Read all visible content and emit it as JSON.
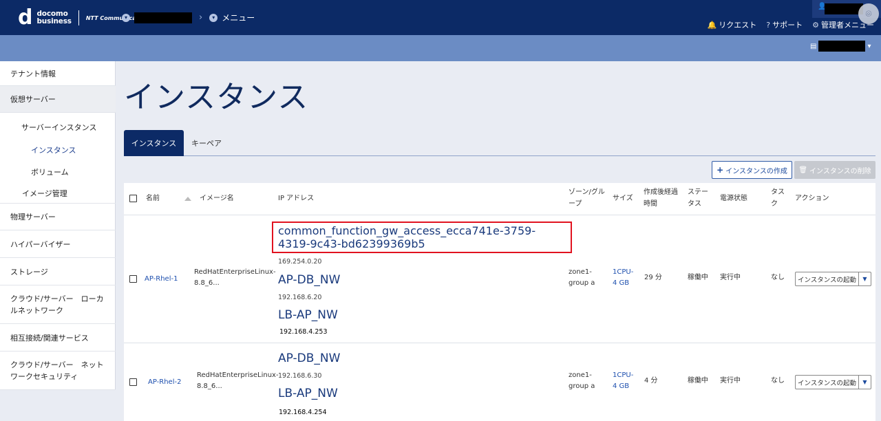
{
  "header": {
    "logo_docomo": "docomo",
    "logo_business": "business",
    "logo_ntt": "NTT Communications",
    "breadcrumb_menu": "メニュー",
    "request": "リクエスト",
    "support": "サポート",
    "admin_menu": "管理者メニュー"
  },
  "sidebar": {
    "tenant_info": "テナント情報",
    "virtual_server": "仮想サーバー",
    "server_instance": "サーバーインスタンス",
    "instance": "インスタンス",
    "volume": "ボリューム",
    "image_mgmt": "イメージ管理",
    "physical_server": "物理サーバー",
    "hypervisor": "ハイパーバイザー",
    "storage": "ストレージ",
    "cloud_local_net": "クラウド/サーバー　ローカルネットワーク",
    "interconnect": "相互接続/関連サービス",
    "cloud_net_security": "クラウド/サーバー　ネットワークセキュリティ"
  },
  "page": {
    "title": "インスタンス",
    "tabs": [
      "インスタンス",
      "キーペア"
    ],
    "create_button": "インスタンスの作成",
    "delete_button": "インスタンスの削除"
  },
  "table": {
    "headers": {
      "name": "名前",
      "image": "イメージ名",
      "ip": "IP アドレス",
      "zone": "ゾーン/グループ",
      "size": "サイズ",
      "elapsed": "作成後経過時間",
      "status": "ステータス",
      "power": "電源状態",
      "task": "タスク",
      "action": "アクション"
    },
    "rows": [
      {
        "name": "AP-Rhel-1",
        "image": "RedHatEnterpriseLinux-8.8_6...",
        "highlight_net": "common_function_gw_access_ecca741e-3759-4319-9c43-bd62399369b5",
        "ip1": "169.254.0.20",
        "net2": "AP-DB_NW",
        "ip2": "192.168.6.20",
        "net3": "LB-AP_NW",
        "ip3": "192.168.4.253",
        "zone": "zone1-group a",
        "size": "1CPU-4 GB",
        "elapsed": "29 分",
        "status": "稼働中",
        "power": "実行中",
        "task": "なし",
        "action": "インスタンスの起動"
      },
      {
        "name": "AP-Rhel-2",
        "image": "RedHatEnterpriseLinux-8.8_6...",
        "net2": "AP-DB_NW",
        "ip2": "192.168.6.30",
        "net3": "LB-AP_NW",
        "ip3": "192.168.4.254",
        "zone": "zone1-group a",
        "size": "1CPU-4 GB",
        "elapsed": "4 分",
        "status": "稼働中",
        "power": "実行中",
        "task": "なし",
        "action": "インスタンスの起動"
      }
    ]
  }
}
